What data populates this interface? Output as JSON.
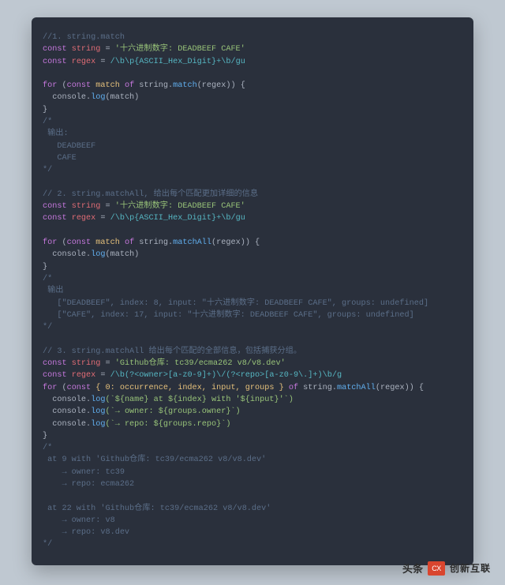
{
  "code": {
    "s1_comment": "//1. string.match",
    "s1_l1_kw": "const",
    "s1_l1_id": "string",
    "s1_l1_eq": " = ",
    "s1_l1_str": "'十六进制数字: DEADBEEF CAFE'",
    "s1_l2_kw": "const",
    "s1_l2_id": "regex",
    "s1_l2_eq": " = ",
    "s1_l2_reg": "/\\b\\p{ASCII_Hex_Digit}+\\b/gu",
    "s1_for_kw1": "for",
    "s1_for_p": " (",
    "s1_for_kw2": "const",
    "s1_for_id": " match ",
    "s1_for_kw3": "of",
    "s1_for_rest_a": " string.",
    "s1_for_fn": "match",
    "s1_for_rest_b": "(regex)) {",
    "s1_log_a": "  console.",
    "s1_log_fn": "log",
    "s1_log_b": "(match)",
    "brace_close": "}",
    "s1_out": "/*\n 输出:\n   DEADBEEF\n   CAFE\n*/",
    "s2_comment": "// 2. string.matchAll, 给出每个匹配更加详细的信息",
    "s2_l1_kw": "const",
    "s2_l1_id": "string",
    "s2_l1_eq": " = ",
    "s2_l1_str": "'十六进制数字: DEADBEEF CAFE'",
    "s2_l2_kw": "const",
    "s2_l2_id": "regex",
    "s2_l2_eq": " = ",
    "s2_l2_reg": "/\\b\\p{ASCII_Hex_Digit}+\\b/gu",
    "s2_for_kw1": "for",
    "s2_for_p": " (",
    "s2_for_kw2": "const",
    "s2_for_id": " match ",
    "s2_for_kw3": "of",
    "s2_for_rest_a": " string.",
    "s2_for_fn": "matchAll",
    "s2_for_rest_b": "(regex)) {",
    "s2_log_a": "  console.",
    "s2_log_fn": "log",
    "s2_log_b": "(match)",
    "s2_out": "/*\n 输出\n   [\"DEADBEEF\", index: 8, input: \"十六进制数字: DEADBEEF CAFE\", groups: undefined]\n   [\"CAFE\", index: 17, input: \"十六进制数字: DEADBEEF CAFE\", groups: undefined]\n*/",
    "s3_comment": "// 3. string.matchAll 给出每个匹配的全部信息，包括捕获分组。",
    "s3_l1_kw": "const",
    "s3_l1_id": "string",
    "s3_l1_eq": " = ",
    "s3_l1_str": "'Github仓库: tc39/ecma262 v8/v8.dev'",
    "s3_l2_kw": "const",
    "s3_l2_id": "regex",
    "s3_l2_eq": " = ",
    "s3_l2_reg": "/\\b(?<owner>[a-z0-9]+)\\/(?<repo>[a-z0-9\\.]+)\\b/g",
    "s3_for_kw1": "for",
    "s3_for_p": " (",
    "s3_for_kw2": "const",
    "s3_for_dest": " { 0: occurrence, index, input, groups } ",
    "s3_for_kw3": "of",
    "s3_for_rest_a": " string.",
    "s3_for_fn": "matchAll",
    "s3_for_rest_b": "(regex)) {",
    "s3_log1_a": "  console.",
    "s3_log1_fn": "log",
    "s3_log1_b": "(`${name} at ${index} with '${input}'`)",
    "s3_log2_a": "  console.",
    "s3_log2_fn": "log",
    "s3_log2_b": "(`→ owner: ${groups.owner}`)",
    "s3_log3_a": "  console.",
    "s3_log3_fn": "log",
    "s3_log3_b": "(`→ repo: ${groups.repo}`)",
    "s3_out": "/*\n at 9 with 'Github仓库: tc39/ecma262 v8/v8.dev'\n    → owner: tc39\n    → repo: ecma262\n\n at 22 with 'Github仓库: tc39/ecma262 v8/v8.dev'\n    → owner: v8\n    → repo: v8.dev\n*/"
  },
  "footer": {
    "source": "头条",
    "brand": "创新互联"
  }
}
